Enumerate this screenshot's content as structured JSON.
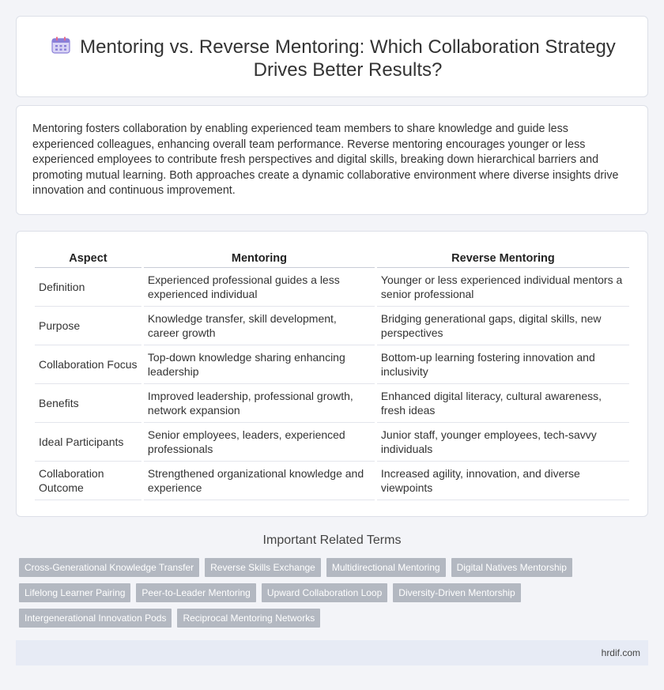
{
  "header": {
    "title": "Mentoring vs. Reverse Mentoring: Which Collaboration Strategy Drives Better Results?",
    "icon": "calendar-icon"
  },
  "intro": {
    "text": "Mentoring fosters collaboration by enabling experienced team members to share knowledge and guide less experienced colleagues, enhancing overall team performance. Reverse mentoring encourages younger or less experienced employees to contribute fresh perspectives and digital skills, breaking down hierarchical barriers and promoting mutual learning. Both approaches create a dynamic collaborative environment where diverse insights drive innovation and continuous improvement."
  },
  "table": {
    "headers": [
      "Aspect",
      "Mentoring",
      "Reverse Mentoring"
    ],
    "rows": [
      [
        "Definition",
        "Experienced professional guides a less experienced individual",
        "Younger or less experienced individual mentors a senior professional"
      ],
      [
        "Purpose",
        "Knowledge transfer, skill development, career growth",
        "Bridging generational gaps, digital skills, new perspectives"
      ],
      [
        "Collaboration Focus",
        "Top-down knowledge sharing enhancing leadership",
        "Bottom-up learning fostering innovation and inclusivity"
      ],
      [
        "Benefits",
        "Improved leadership, professional growth, network expansion",
        "Enhanced digital literacy, cultural awareness, fresh ideas"
      ],
      [
        "Ideal Participants",
        "Senior employees, leaders, experienced professionals",
        "Junior staff, younger employees, tech-savvy individuals"
      ],
      [
        "Collaboration Outcome",
        "Strengthened organizational knowledge and experience",
        "Increased agility, innovation, and diverse viewpoints"
      ]
    ]
  },
  "related": {
    "title": "Important Related Terms",
    "tags": [
      "Cross-Generational Knowledge Transfer",
      "Reverse Skills Exchange",
      "Multidirectional Mentoring",
      "Digital Natives Mentorship",
      "Lifelong Learner Pairing",
      "Peer-to-Leader Mentoring",
      "Upward Collaboration Loop",
      "Diversity-Driven Mentorship",
      "Intergenerational Innovation Pods",
      "Reciprocal Mentoring Networks"
    ]
  },
  "footer": {
    "site": "hrdif.com"
  }
}
